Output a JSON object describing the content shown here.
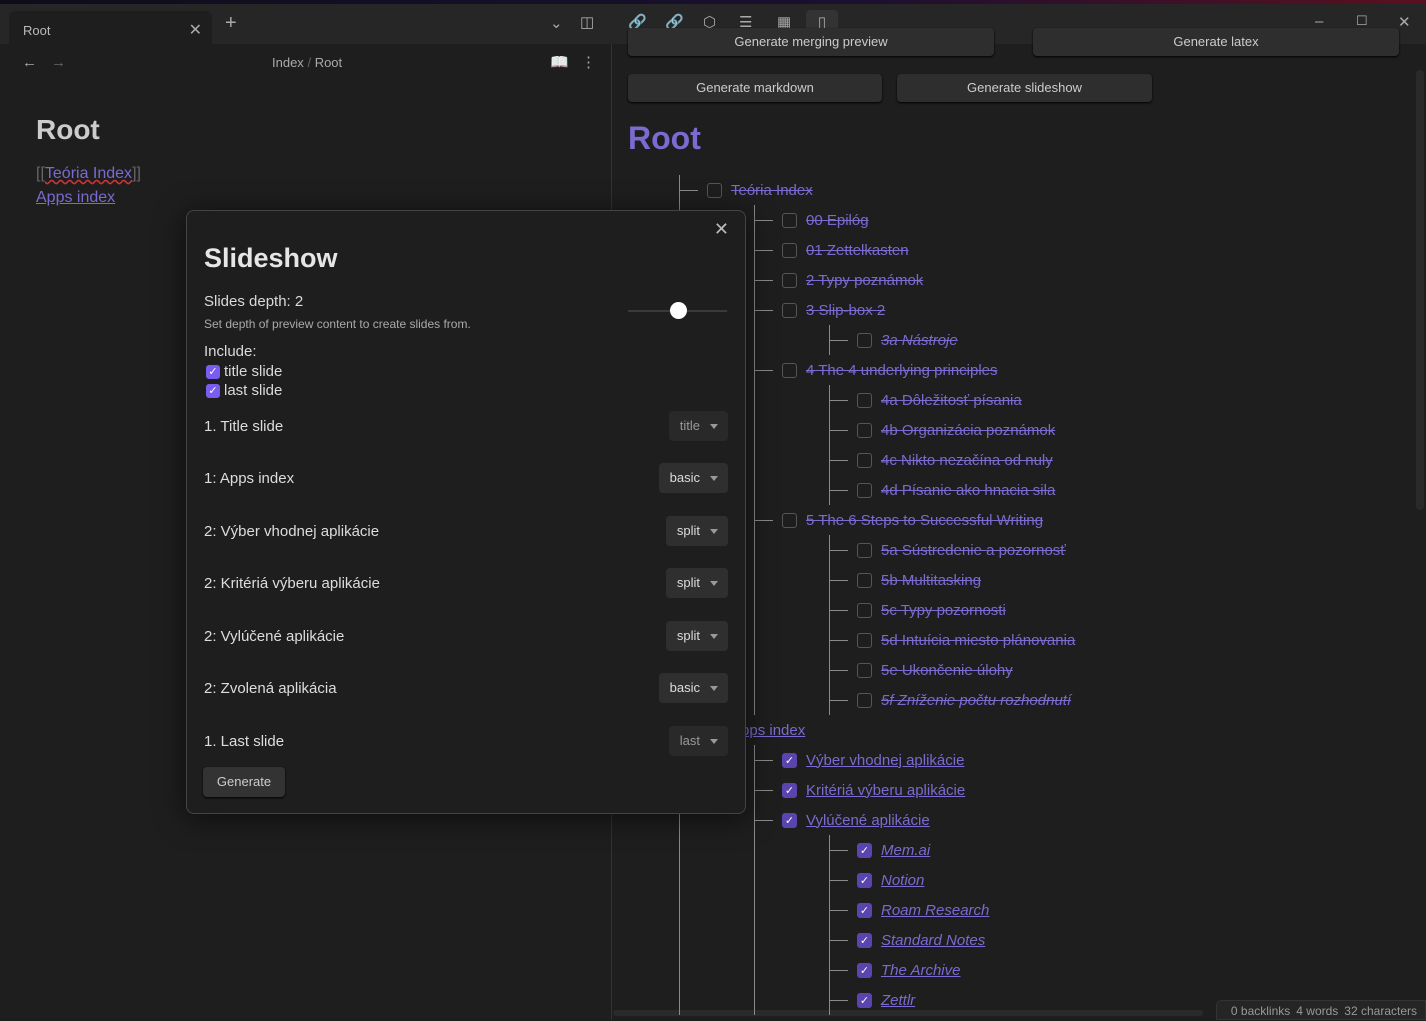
{
  "tab": {
    "title": "Root"
  },
  "breadcrumb": {
    "parent": "Index",
    "sep": "/",
    "current": "Root"
  },
  "left": {
    "title": "Root",
    "wikilink_open": "[[",
    "wikilink_text": "Teória Index",
    "wikilink_close": "]]",
    "link": "Apps index"
  },
  "right": {
    "buttons": {
      "merging": "Generate merging preview",
      "latex": "Generate latex",
      "markdown": "Generate markdown",
      "slideshow": "Generate slideshow"
    },
    "title": "Root",
    "tree": [
      {
        "label": "Teória Index",
        "checked": false,
        "children": [
          {
            "label": "00 Epilóg",
            "checked": false
          },
          {
            "label": "01 Zettelkasten",
            "checked": false
          },
          {
            "label": "2 Typy poznámok",
            "checked": false
          },
          {
            "label": "3 Slip-box 2",
            "checked": false,
            "children": [
              {
                "label": "3a Nástroje",
                "checked": false,
                "italic": true
              }
            ]
          },
          {
            "label": "4 The 4 underlying principles",
            "checked": false,
            "children": [
              {
                "label": "4a Dôležitosť písania",
                "checked": false
              },
              {
                "label": "4b Organizácia poznámok",
                "checked": false
              },
              {
                "label": "4c Nikto nezačína od nuly",
                "checked": false
              },
              {
                "label": "4d Písanie ako hnacia sila",
                "checked": false
              }
            ]
          },
          {
            "label": "5 The 6 Steps to Successful Writing",
            "checked": false,
            "children": [
              {
                "label": "5a Sústredenie a pozornosť",
                "checked": false
              },
              {
                "label": "5b Multitasking",
                "checked": false
              },
              {
                "label": "5c Typy pozornosti",
                "checked": false
              },
              {
                "label": "5d Intuícia miesto plánovania",
                "checked": false
              },
              {
                "label": "5e Ukončenie úlohy",
                "checked": false
              },
              {
                "label": "5f Zníženie počtu rozhodnutí",
                "checked": false,
                "italic": true
              }
            ]
          }
        ]
      },
      {
        "label": "Apps index",
        "checked": true,
        "children": [
          {
            "label": "Výber vhodnej aplikácie",
            "checked": true
          },
          {
            "label": "Kritériá výberu aplikácie",
            "checked": true
          },
          {
            "label": "Vylúčené aplikácie",
            "checked": true,
            "children": [
              {
                "label": "Mem.ai",
                "checked": true,
                "italic": true
              },
              {
                "label": "Notion",
                "checked": true,
                "italic": true
              },
              {
                "label": "Roam Research",
                "checked": true,
                "italic": true
              },
              {
                "label": "Standard Notes",
                "checked": true,
                "italic": true
              },
              {
                "label": "The Archive",
                "checked": true,
                "italic": true
              },
              {
                "label": "Zettlr",
                "checked": true,
                "italic": true
              }
            ]
          }
        ]
      }
    ]
  },
  "modal": {
    "title": "Slideshow",
    "depth_label": "Slides depth: 2",
    "depth_value": 2,
    "depth_desc": "Set depth of preview content to create slides from.",
    "include_label": "Include:",
    "include": [
      {
        "label": "title slide",
        "checked": true
      },
      {
        "label": "last slide",
        "checked": true
      }
    ],
    "slides": [
      {
        "label": "1. Title slide",
        "type": "title",
        "dim": true
      },
      {
        "label": "1: Apps index",
        "type": "basic"
      },
      {
        "label": "2: Výber vhodnej aplikácie",
        "type": "split"
      },
      {
        "label": "2: Kritériá výberu aplikácie",
        "type": "split"
      },
      {
        "label": "2: Vylúčené aplikácie",
        "type": "split"
      },
      {
        "label": "2: Zvolená aplikácia",
        "type": "basic"
      },
      {
        "label": "1. Last slide",
        "type": "last",
        "dim": true
      }
    ],
    "generate": "Generate"
  },
  "status": {
    "backlinks": "0 backlinks",
    "words": "4 words",
    "chars": "32 characters"
  },
  "colors": {
    "accent": "#7b6ad0",
    "checkbox": "#5a44b0",
    "bg": "#1e1e1e"
  }
}
